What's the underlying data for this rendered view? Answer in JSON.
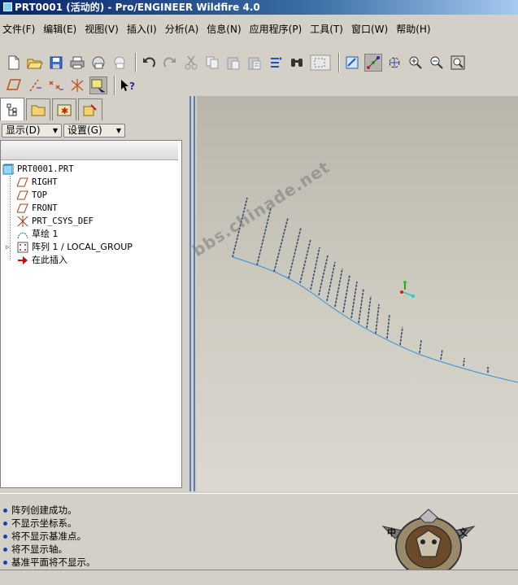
{
  "window": {
    "title": "PRT0001 (活动的) - Pro/ENGINEER Wildfire 4.0"
  },
  "menu": [
    {
      "label": "文件(F)",
      "key": "F"
    },
    {
      "label": "编辑(E)",
      "key": "E"
    },
    {
      "label": "视图(V)",
      "key": "V"
    },
    {
      "label": "插入(I)",
      "key": "I"
    },
    {
      "label": "分析(A)",
      "key": "A"
    },
    {
      "label": "信息(N)",
      "key": "N"
    },
    {
      "label": "应用程序(P)",
      "key": "P"
    },
    {
      "label": "工具(T)",
      "key": "T"
    },
    {
      "label": "窗口(W)",
      "key": "W"
    },
    {
      "label": "帮助(H)",
      "key": "H"
    }
  ],
  "toolbar": {
    "row1_icons": [
      "new-icon",
      "open-icon",
      "save-icon",
      "print-icon",
      "send-mail-icon",
      "send-attachment-icon",
      "undo-icon",
      "redo-icon",
      "cut-icon",
      "copy-icon",
      "paste-icon",
      "paste-special-icon",
      "regenerate-icon",
      "find-icon",
      "select-box-icon",
      "repaint-icon",
      "spin-center-icon",
      "orient-mode-icon",
      "zoom-in-icon",
      "zoom-out-icon",
      "refit-icon"
    ],
    "row2_icons": [
      "plane-display-icon",
      "axis-display-icon",
      "point-display-icon",
      "csys-display-icon",
      "annotation-display-icon",
      "context-help-icon"
    ]
  },
  "panel": {
    "tabs": [
      "model-tree-tab",
      "folder-browser-tab",
      "favorites-tab",
      "connections-tab"
    ],
    "show_label": "显示(D)",
    "settings_label": "设置(G)"
  },
  "tree": {
    "root": "PRT0001.PRT",
    "items": [
      {
        "label": "RIGHT",
        "icon": "datum-plane-icon"
      },
      {
        "label": "TOP",
        "icon": "datum-plane-icon"
      },
      {
        "label": "FRONT",
        "icon": "datum-plane-icon"
      },
      {
        "label": "PRT_CSYS_DEF",
        "icon": "csys-icon"
      },
      {
        "label": "草绘 1",
        "icon": "sketch-icon"
      },
      {
        "label": "阵列 1 / LOCAL_GROUP",
        "icon": "pattern-icon"
      },
      {
        "label": "在此插入",
        "icon": "insert-here-arrow-icon"
      }
    ]
  },
  "messages": [
    "阵列创建成功。",
    "不显示坐标系。",
    "将不显示基准点。",
    "将不显示轴。",
    "基准平面将不显示。"
  ],
  "watermark": "bbs.chinade.net",
  "emblem_text": [
    "中",
    "文"
  ],
  "colors": {
    "title_blue": "#0a246a",
    "curve_blue": "#3b8fd9",
    "message_dot": "#1a3cc8"
  }
}
